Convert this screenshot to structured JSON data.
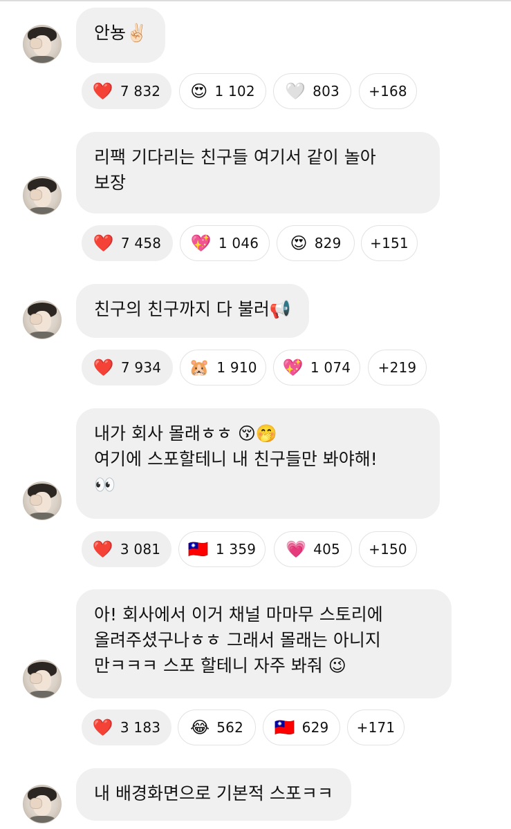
{
  "messages": [
    {
      "text": "안뇽✌🏻",
      "reactions": [
        {
          "emoji": "❤️",
          "count": "7 832"
        },
        {
          "emoji": "😍",
          "count": "1 102"
        },
        {
          "emoji": "🤍",
          "count": "803"
        },
        {
          "emoji": "",
          "count": "+168"
        }
      ]
    },
    {
      "text": "리팩 기다리는 친구들 여기서 같이 놀아\n보장",
      "reactions": [
        {
          "emoji": "❤️",
          "count": "7 458"
        },
        {
          "emoji": "💖",
          "count": "1 046"
        },
        {
          "emoji": "😍",
          "count": "829"
        },
        {
          "emoji": "",
          "count": "+151"
        }
      ]
    },
    {
      "text": "친구의 친구까지 다 불러📢",
      "reactions": [
        {
          "emoji": "❤️",
          "count": "7 934"
        },
        {
          "emoji": "🐹",
          "count": "1 910"
        },
        {
          "emoji": "💖",
          "count": "1 074"
        },
        {
          "emoji": "",
          "count": "+219"
        }
      ]
    },
    {
      "text": "내가 회사 몰래ㅎㅎ 😚🤭\n여기에 스포할테니 내 친구들만 봐야해!\n👀",
      "reactions": [
        {
          "emoji": "❤️",
          "count": "3 081"
        },
        {
          "emoji": "🇹🇼",
          "count": "1 359"
        },
        {
          "emoji": "💗",
          "count": "405"
        },
        {
          "emoji": "",
          "count": "+150"
        }
      ]
    },
    {
      "text": "아! 회사에서 이거 채널 마마무 스토리에\n올려주셨구나ㅎㅎ 그래서 몰래는 아니지\n만ㅋㅋㅋ 스포 할테니 자주 봐줘 😉",
      "reactions": [
        {
          "emoji": "❤️",
          "count": "3 183"
        },
        {
          "emoji": "😂",
          "count": "562"
        },
        {
          "emoji": "🇹🇼",
          "count": "629"
        },
        {
          "emoji": "",
          "count": "+171"
        }
      ]
    },
    {
      "text": "내 배경화면으로 기본적 스포ㅋㅋ",
      "reactions": []
    }
  ]
}
